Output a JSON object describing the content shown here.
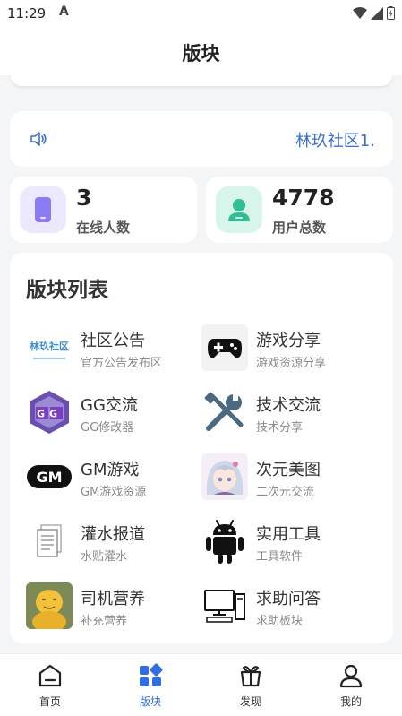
{
  "status_bar": {
    "time": "11:29",
    "notif_glyph": "A"
  },
  "header": {
    "title": "版块"
  },
  "notice": {
    "text": "林玖社区1.",
    "icon": "speaker-icon"
  },
  "stats": [
    {
      "value": "3",
      "label": "在线人数",
      "icon": "phone-icon",
      "color": "#8b7cf6"
    },
    {
      "value": "4778",
      "label": "用户总数",
      "icon": "user-icon",
      "color": "#2fbf95"
    }
  ],
  "forum_section": {
    "title": "版块列表",
    "forums": [
      {
        "name": "社区公告",
        "desc": "官方公告发布区",
        "icon": "linjiu-logo",
        "logo_text": "林玖社区"
      },
      {
        "name": "游戏分享",
        "desc": "游戏资源分享",
        "icon": "gamepad-icon"
      },
      {
        "name": "GG交流",
        "desc": "GG修改器",
        "icon": "gg-icon",
        "logo_text": "GG"
      },
      {
        "name": "技术交流",
        "desc": "技术分享",
        "icon": "tools-icon"
      },
      {
        "name": "GM游戏",
        "desc": "GM游戏资源",
        "icon": "gm-icon",
        "logo_text": "GM"
      },
      {
        "name": "次元美图",
        "desc": "二次元交流",
        "icon": "anime-girl-image"
      },
      {
        "name": "灌水报道",
        "desc": "水贴灌水",
        "icon": "document-icon"
      },
      {
        "name": "实用工具",
        "desc": "工具软件",
        "icon": "android-icon"
      },
      {
        "name": "司机营养",
        "desc": "补充营养",
        "icon": "yellow-figure-image"
      },
      {
        "name": "求助问答",
        "desc": "求助板块",
        "icon": "computer-icon"
      }
    ]
  },
  "tabbar": {
    "accent": "#2f6ee5",
    "tabs": [
      {
        "label": "首页",
        "icon": "home-icon"
      },
      {
        "label": "版块",
        "icon": "grid-icon",
        "active": true
      },
      {
        "label": "发现",
        "icon": "discover-icon"
      },
      {
        "label": "我的",
        "icon": "profile-icon"
      }
    ]
  }
}
